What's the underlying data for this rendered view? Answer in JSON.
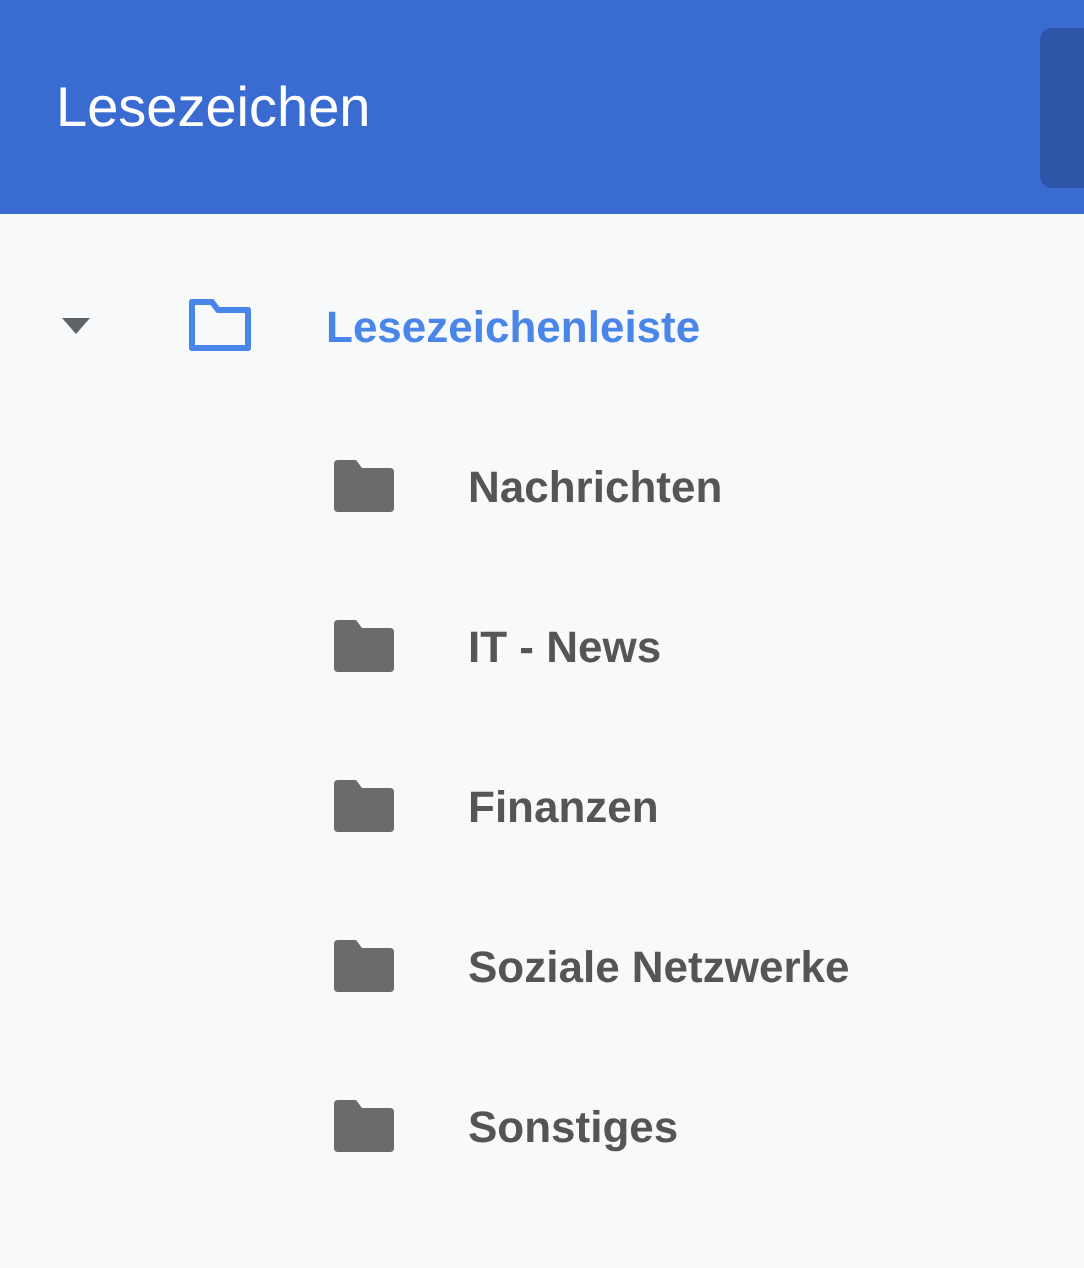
{
  "header": {
    "title": "Lesezeichen"
  },
  "tree": [
    {
      "label": "Lesezeichenleiste",
      "expanded": true,
      "selected": true,
      "children": [
        {
          "label": "Nachrichten",
          "selected": false
        },
        {
          "label": "IT - News",
          "selected": false
        },
        {
          "label": "Finanzen",
          "selected": false
        },
        {
          "label": "Soziale Netzwerke",
          "selected": false
        },
        {
          "label": "Sonstiges",
          "selected": false
        }
      ]
    }
  ]
}
